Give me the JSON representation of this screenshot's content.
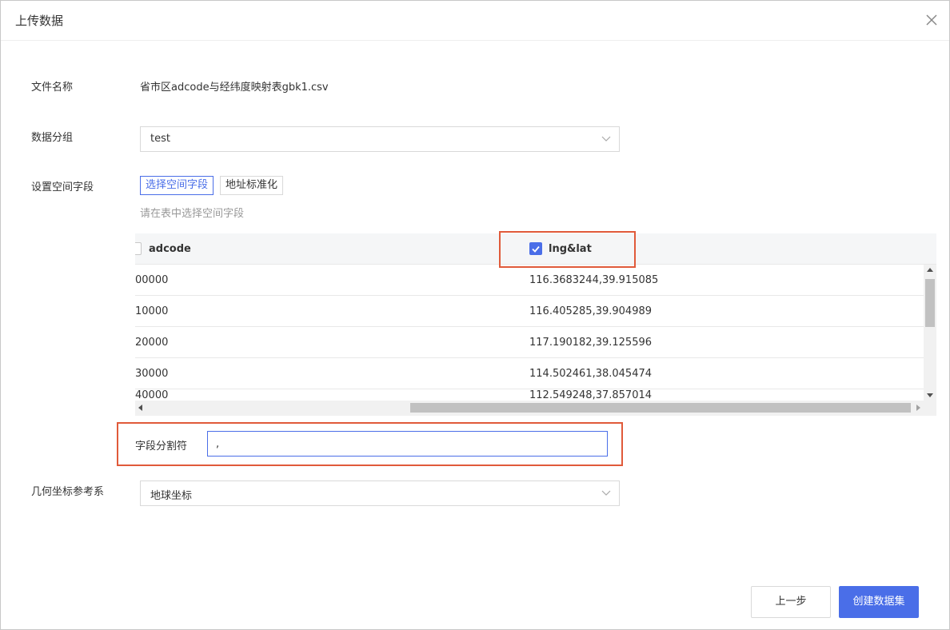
{
  "dialog": {
    "title": "上传数据",
    "close_icon": "close-icon"
  },
  "form": {
    "file_name_label": "文件名称",
    "file_name_value": "省市区adcode与经纬度映射表gbk1.csv",
    "group_label": "数据分组",
    "group_value": "test",
    "spatial_label": "设置空间字段",
    "spatial_modes": [
      "选择空间字段",
      "地址标准化"
    ],
    "spatial_mode_active": "选择空间字段",
    "spatial_hint": "请在表中选择空间字段",
    "delimiter_label": "字段分割符",
    "delimiter_value": ",",
    "crs_label": "几何坐标参考系",
    "crs_value": "地球坐标"
  },
  "table": {
    "columns": [
      {
        "label": "adcode",
        "checked": false
      },
      {
        "label": "lng&lat",
        "checked": true
      }
    ],
    "rows": [
      [
        "00000",
        "116.3683244,39.915085"
      ],
      [
        "10000",
        "116.405285,39.904989"
      ],
      [
        "20000",
        "117.190182,39.125596"
      ],
      [
        "30000",
        "114.502461,38.045474"
      ],
      [
        "40000",
        "112.549248,37.857014"
      ]
    ]
  },
  "footer": {
    "prev_label": "上一步",
    "create_label": "创建数据集"
  },
  "colors": {
    "accent": "#4a6ee8",
    "highlight_box": "#e05a3a"
  }
}
